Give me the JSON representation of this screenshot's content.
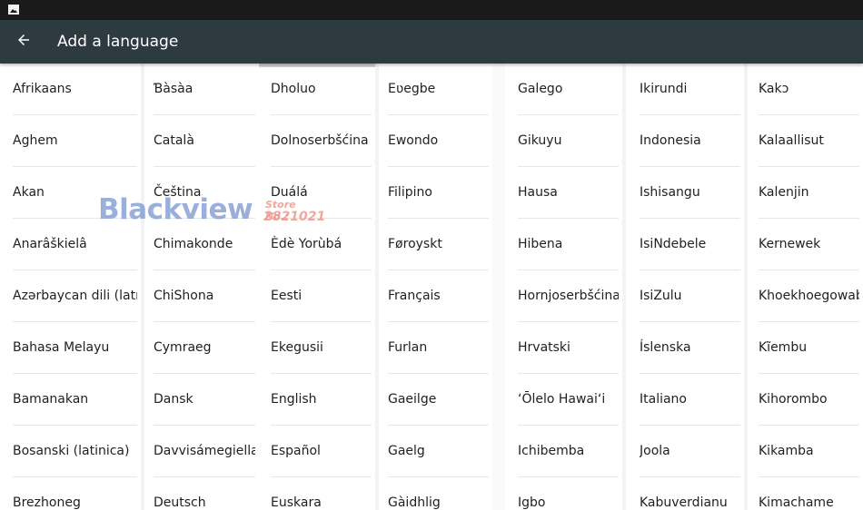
{
  "app_bar": {
    "title": "Add a language",
    "background": "#2d3a40"
  },
  "status_bar": {
    "icon": "image-icon"
  },
  "watermark": {
    "brand": "Blackview",
    "store_label": "Store No.:",
    "store_number": "2821021"
  },
  "languages_left": [
    [
      "Afrikaans",
      "Ɓàsàa",
      "Dholuo",
      "Eʋegbe"
    ],
    [
      "Aghem",
      "Català",
      "Dolnoserbšćina",
      "Ewondo"
    ],
    [
      "Akan",
      "Čeština",
      "Duálá",
      "Filipino"
    ],
    [
      "Anarâškielâ",
      "Chimakonde",
      "Èdè Yorùbá",
      "Føroyskt"
    ],
    [
      "Azərbaycan dili (latın)",
      "ChiShona",
      "Eesti",
      "Français"
    ],
    [
      "Bahasa Melayu",
      "Cymraeg",
      "Ekegusii",
      "Furlan"
    ],
    [
      "Bamanakan",
      "Dansk",
      "English",
      "Gaeilge"
    ],
    [
      "Bosanski (latinica)",
      "Davvisámegiella",
      "Español",
      "Gaelg"
    ],
    [
      "Brezhoneg",
      "Deutsch",
      "Euskara",
      "Gàidhlig"
    ]
  ],
  "languages_right": [
    [
      "Galego",
      "Ikirundi",
      "Kakɔ"
    ],
    [
      "Gikuyu",
      "Indonesia",
      "Kalaallisut"
    ],
    [
      "Hausa",
      "Ishisangu",
      "Kalenjin"
    ],
    [
      "Hibena",
      "IsiNdebele",
      "Kernewek"
    ],
    [
      "Hornjoserbšćina",
      "IsiZulu",
      "Khoekhoegowab"
    ],
    [
      "Hrvatski",
      "Íslenska",
      "Kĩembu"
    ],
    [
      "ʻŌlelo Hawaiʻi",
      "Italiano",
      "Kihorombo"
    ],
    [
      "Ichibemba",
      "Joola",
      "Kikamba"
    ],
    [
      "Igbo",
      "Kabuverdianu",
      "Kimachame"
    ]
  ]
}
